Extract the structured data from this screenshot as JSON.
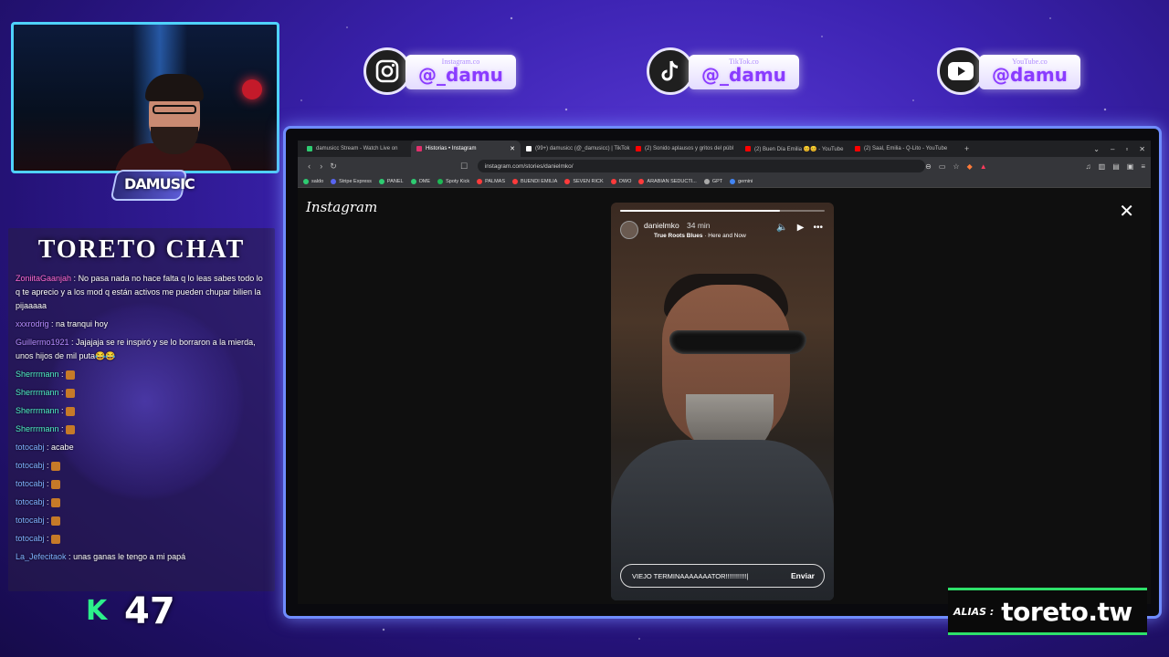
{
  "colors": {
    "accent": "#8a3cff",
    "alias_green": "#2ee06a",
    "frame_blue": "#6f8cff"
  },
  "socials": [
    {
      "site": "Instagram.co",
      "handle": "@_damu",
      "icon": "instagram-icon"
    },
    {
      "site": "TikTok.co",
      "handle": "@_damu",
      "icon": "tiktok-icon"
    },
    {
      "site": "YouTube.co",
      "handle": "@damu",
      "icon": "youtube-icon"
    }
  ],
  "channel_logo": "DAMUSIC",
  "chat": {
    "title": "TORETO CHAT",
    "messages": [
      {
        "user": "ZoniitaGaanjah",
        "color": "#ff6ad5",
        "text": "No pasa nada no hace falta q lo leas sabes todo lo q te aprecio y a los mod q están activos me pueden chupar bilien la pijaaaaa"
      },
      {
        "user": "xxxrodrig",
        "color": "#b58cff",
        "text": "na tranqui hoy"
      },
      {
        "user": "Guillermo1921",
        "color": "#b58cff",
        "text": "Jajajaja se re inspiró y se lo borraron a la mierda, unos hijos de mil puta😂😂"
      },
      {
        "user": "Sherrrmann",
        "color": "#4ff2c6",
        "text": ""
      },
      {
        "user": "Sherrrmann",
        "color": "#4ff2c6",
        "text": ""
      },
      {
        "user": "Sherrrmann",
        "color": "#4ff2c6",
        "text": ""
      },
      {
        "user": "Sherrrmann",
        "color": "#4ff2c6",
        "text": ""
      },
      {
        "user": "totocabj",
        "color": "#7fb2ff",
        "text": "acabe"
      },
      {
        "user": "totocabj",
        "color": "#7fb2ff",
        "text": ""
      },
      {
        "user": "totocabj",
        "color": "#7fb2ff",
        "text": ""
      },
      {
        "user": "totocabj",
        "color": "#7fb2ff",
        "text": ""
      },
      {
        "user": "totocabj",
        "color": "#7fb2ff",
        "text": ""
      },
      {
        "user": "totocabj",
        "color": "#7fb2ff",
        "text": ""
      },
      {
        "user": "La_Jefecitaok",
        "color": "#7fb2ff",
        "text": "unas ganas le tengo a mi papá"
      }
    ]
  },
  "counter": {
    "value": "47"
  },
  "browser": {
    "tabs": [
      {
        "title": "damusicc Stream - Watch Live on",
        "color": "#2ecc71",
        "active": false
      },
      {
        "title": "Historias • Instagram",
        "color": "#e1306c",
        "active": true
      },
      {
        "title": "(99+) damusicc (@_damusicc) | TikTok",
        "color": "#ffffff",
        "active": false
      },
      {
        "title": "(2) Sonido aplausos y gritos del públ",
        "color": "#ff0000",
        "active": false
      },
      {
        "title": "(2) Buen Día Emilia 😊😊 - YouTube",
        "color": "#ff0000",
        "active": false
      },
      {
        "title": "(2) Saal, Emilia - Q-Lito - YouTube",
        "color": "#ff0000",
        "active": false
      }
    ],
    "url": "instagram.com/stories/danielmko/",
    "bookmarks": [
      "saldo",
      "Stripe Express",
      "PANEL",
      "OME",
      "Spoty Kick",
      "PALMAS",
      "BUENDI EMILIA",
      "SEVEN RICK",
      "OWO",
      "ARABIAN SEDUCTI...",
      "GPT",
      "gemini"
    ]
  },
  "instagram": {
    "logo": "Instagram",
    "story": {
      "username": "danielmko",
      "time": "34 min",
      "song_title": "True Roots Blues",
      "song_artist": "· Here and Now",
      "progress": 0.78,
      "reply_text": "VIEJO TERMINAAAAAAATOR!!!!!!!!!!!|",
      "send_label": "Enviar"
    }
  },
  "alias": {
    "label": "ALIAS :",
    "value": "toreto.tw"
  }
}
